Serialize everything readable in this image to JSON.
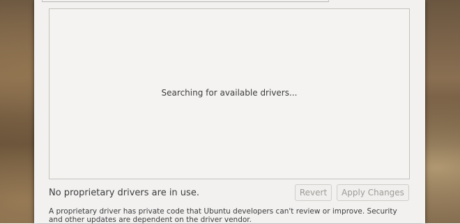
{
  "drivers_panel": {
    "searching_text": "Searching for available drivers..."
  },
  "status": {
    "text": "No proprietary drivers are in use."
  },
  "buttons": {
    "revert_label": "Revert",
    "apply_label": "Apply Changes"
  },
  "info": {
    "text": "A proprietary driver has private code that Ubuntu developers can't review or improve. Security and other updates are dependent on the driver vendor."
  }
}
